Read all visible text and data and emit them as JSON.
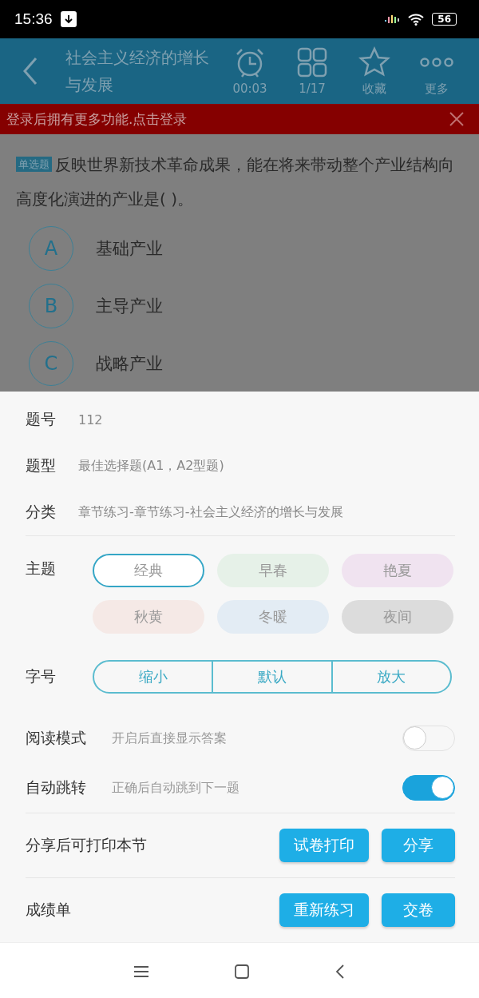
{
  "status_bar": {
    "time": "15:36",
    "battery": "56"
  },
  "app_bar": {
    "title": "社会主义经济的增长与发展",
    "actions": [
      {
        "kind": "timer",
        "label": "00:03"
      },
      {
        "kind": "grid",
        "label": "1/17"
      },
      {
        "kind": "star",
        "label": "收藏"
      },
      {
        "kind": "more",
        "label": "更多"
      }
    ]
  },
  "login_banner": {
    "text": "登录后拥有更多功能.点击登录"
  },
  "question": {
    "type_badge": "单选题",
    "text": "反映世界新技术革命成果，能在将来带动整个产业结构向高度化演进的产业是(   )。",
    "options": [
      {
        "letter": "A",
        "text": "基础产业"
      },
      {
        "letter": "B",
        "text": "主导产业"
      },
      {
        "letter": "C",
        "text": "战略产业"
      }
    ]
  },
  "settings": {
    "info": [
      {
        "label": "题号",
        "value": "112"
      },
      {
        "label": "题型",
        "value": "最佳选择题(A1，A2型题)"
      },
      {
        "label": "分类",
        "value": "章节练习-章节练习-社会主义经济的增长与发展"
      }
    ],
    "theme": {
      "label": "主题",
      "options": [
        {
          "label": "经典",
          "color": "#ffffff",
          "selected": true
        },
        {
          "label": "早春",
          "color": "#e6f1e8",
          "selected": false
        },
        {
          "label": "艳夏",
          "color": "#f0e3f0",
          "selected": false
        },
        {
          "label": "秋黄",
          "color": "#f5e9e6",
          "selected": false
        },
        {
          "label": "冬暖",
          "color": "#e3ecf4",
          "selected": false
        },
        {
          "label": "夜间",
          "color": "#dcdcdc",
          "selected": false
        }
      ]
    },
    "font_size": {
      "label": "字号",
      "options": [
        "缩小",
        "默认",
        "放大"
      ]
    },
    "toggles": [
      {
        "label": "阅读模式",
        "hint": "开启后直接显示答案",
        "on": false
      },
      {
        "label": "自动跳转",
        "hint": "正确后自动跳到下一题",
        "on": true
      }
    ],
    "action_rows": [
      {
        "label": "分享后可打印本节",
        "buttons": [
          "试卷打印",
          "分享"
        ]
      },
      {
        "label": "成绩单",
        "buttons": [
          "重新练习",
          "交卷"
        ]
      }
    ]
  }
}
